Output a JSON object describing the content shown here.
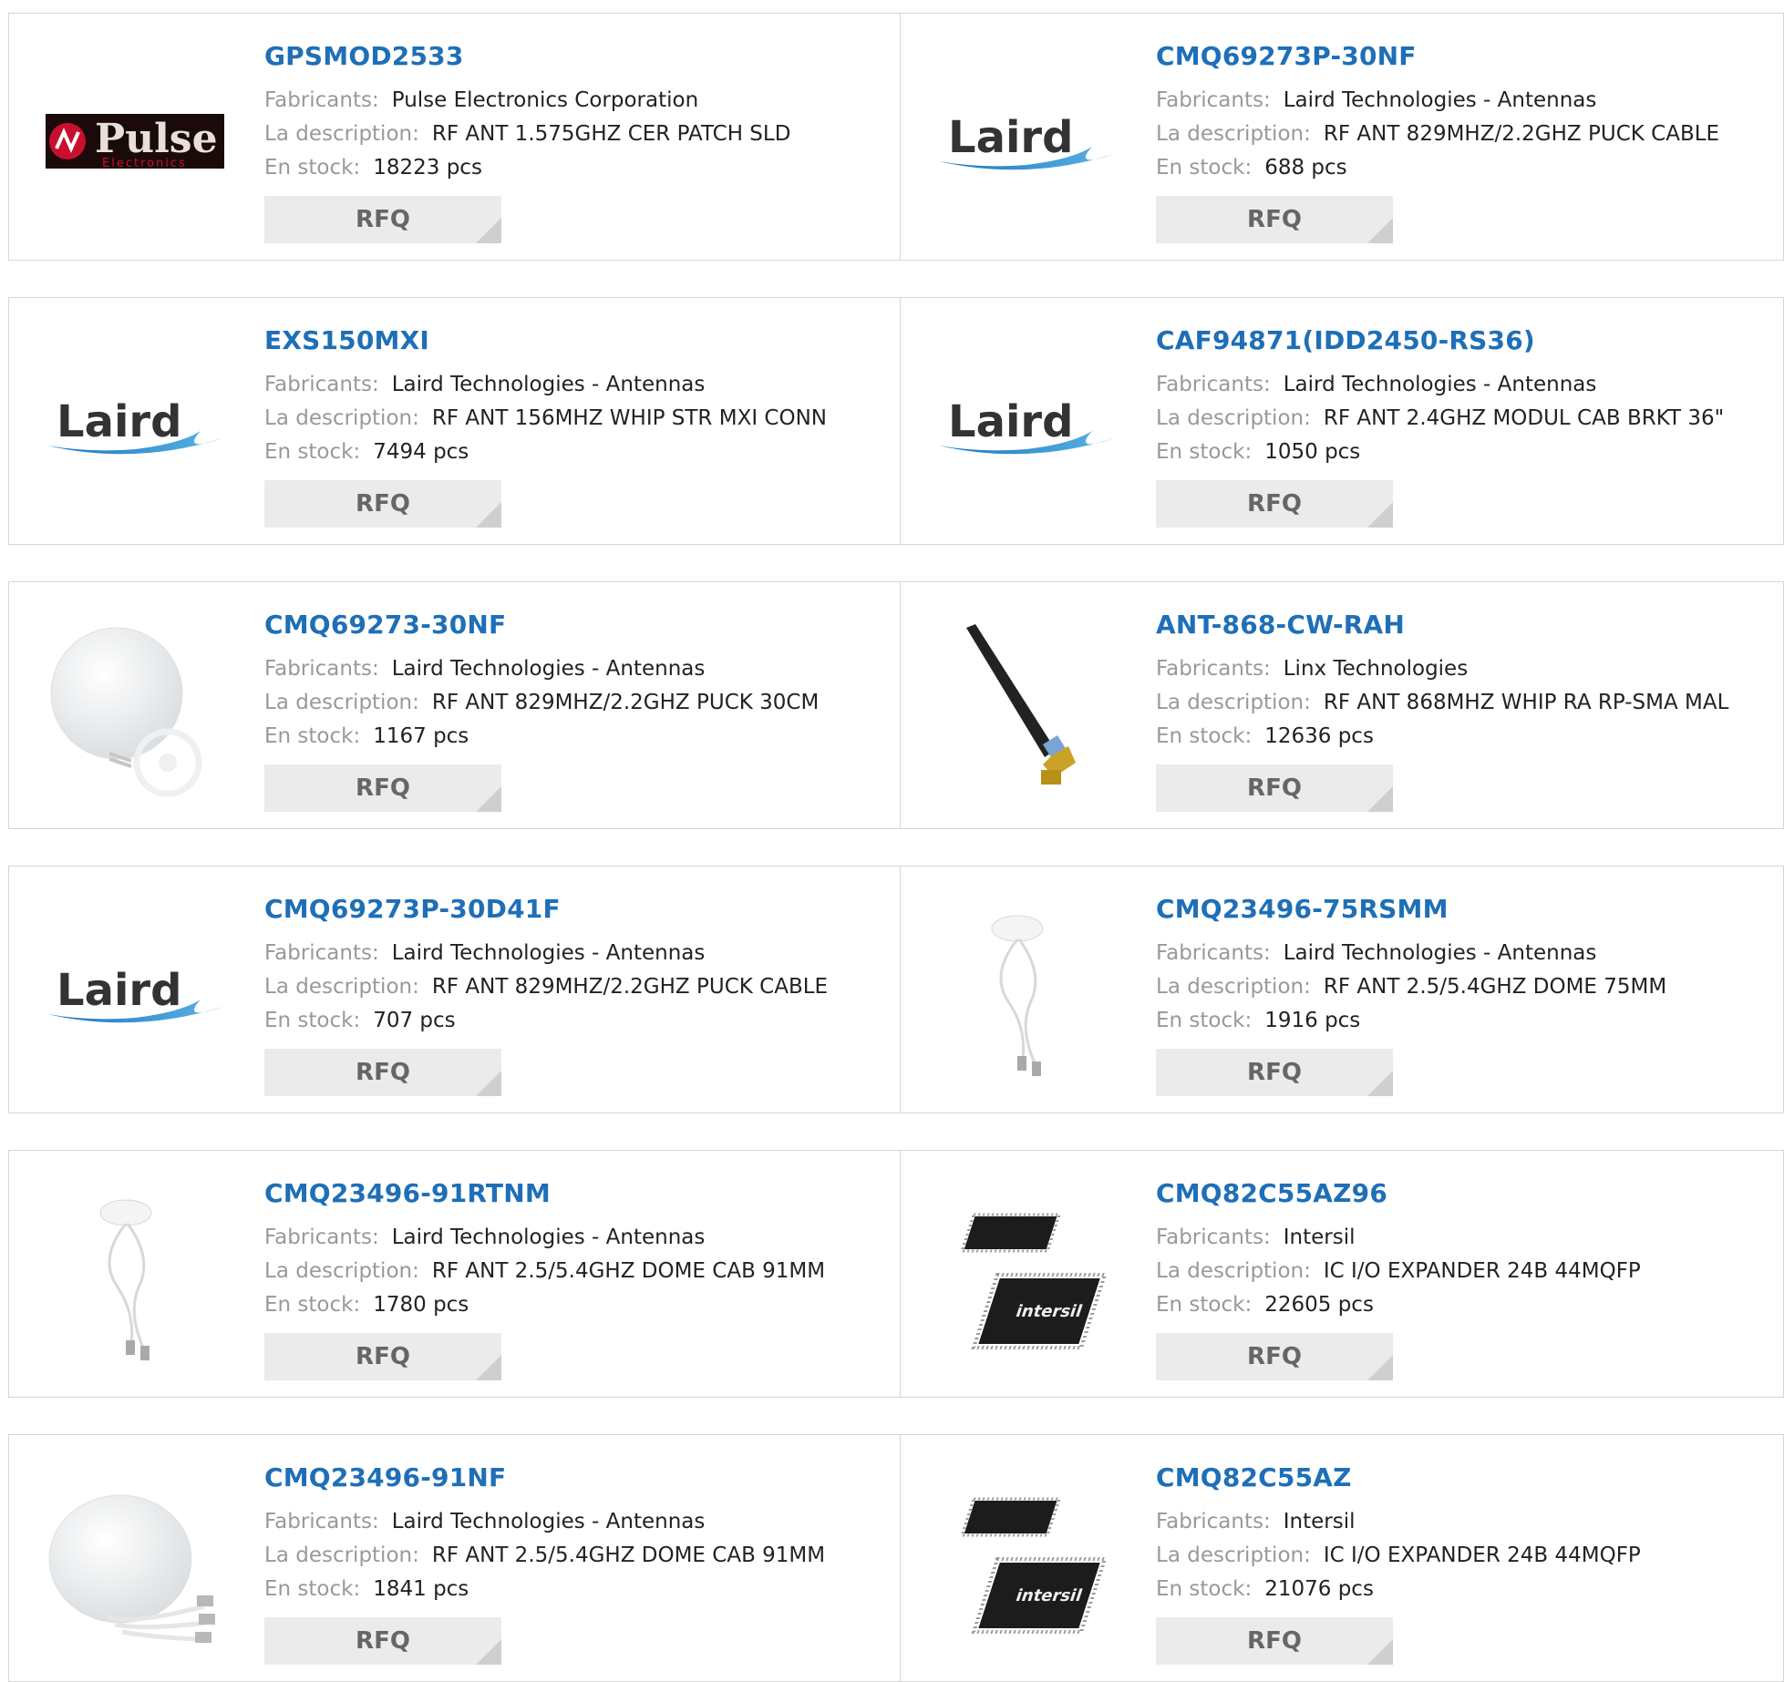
{
  "labels": {
    "manufacturer": "Fabricants:",
    "description": "La description:",
    "stock": "En stock:",
    "rfq": "RFQ"
  },
  "colors": {
    "link": "#1e6fb7",
    "label": "#999999",
    "button_bg": "#ebebeb",
    "border": "#d6d6d6"
  },
  "products": [
    {
      "part": "GPSMOD2533",
      "manufacturer": "Pulse Electronics Corporation",
      "description": "RF ANT 1.575GHZ CER PATCH SLD",
      "stock": "18223 pcs",
      "image": "pulse-logo"
    },
    {
      "part": "CMQ69273P-30NF",
      "manufacturer": "Laird Technologies - Antennas",
      "description": "RF ANT 829MHZ/2.2GHZ PUCK CABLE",
      "stock": "688 pcs",
      "image": "laird-logo"
    },
    {
      "part": "EXS150MXI",
      "manufacturer": "Laird Technologies - Antennas",
      "description": "RF ANT 156MHZ WHIP STR MXI CONN",
      "stock": "7494 pcs",
      "image": "laird-logo"
    },
    {
      "part": "CAF94871(IDD2450-RS36)",
      "manufacturer": "Laird Technologies - Antennas",
      "description": "RF ANT 2.4GHZ MODUL CAB BRKT 36\"",
      "stock": "1050 pcs",
      "image": "laird-logo"
    },
    {
      "part": "CMQ69273-30NF",
      "manufacturer": "Laird Technologies - Antennas",
      "description": "RF ANT 829MHZ/2.2GHZ PUCK 30CM",
      "stock": "1167 pcs",
      "image": "puck-antenna"
    },
    {
      "part": "ANT-868-CW-RAH",
      "manufacturer": "Linx Technologies",
      "description": "RF ANT 868MHZ WHIP RA RP-SMA MAL",
      "stock": "12636 pcs",
      "image": "whip-antenna"
    },
    {
      "part": "CMQ69273P-30D41F",
      "manufacturer": "Laird Technologies - Antennas",
      "description": "RF ANT 829MHZ/2.2GHZ PUCK CABLE",
      "stock": "707 pcs",
      "image": "laird-logo"
    },
    {
      "part": "CMQ23496-75RSMM",
      "manufacturer": "Laird Technologies - Antennas",
      "description": "RF ANT 2.5/5.4GHZ DOME 75MM",
      "stock": "1916 pcs",
      "image": "dome-antenna"
    },
    {
      "part": "CMQ23496-91RTNM",
      "manufacturer": "Laird Technologies - Antennas",
      "description": "RF ANT 2.5/5.4GHZ DOME CAB 91MM",
      "stock": "1780 pcs",
      "image": "dome-antenna"
    },
    {
      "part": "CMQ82C55AZ96",
      "manufacturer": "Intersil",
      "description": "IC I/O EXPANDER 24B 44MQFP",
      "stock": "22605 pcs",
      "image": "ic-chip"
    },
    {
      "part": "CMQ23496-91NF",
      "manufacturer": "Laird Technologies - Antennas",
      "description": "RF ANT 2.5/5.4GHZ DOME CAB 91MM",
      "stock": "1841 pcs",
      "image": "puck-antenna-large"
    },
    {
      "part": "CMQ82C55AZ",
      "manufacturer": "Intersil",
      "description": "IC I/O EXPANDER 24B 44MQFP",
      "stock": "21076 pcs",
      "image": "ic-chip"
    }
  ]
}
